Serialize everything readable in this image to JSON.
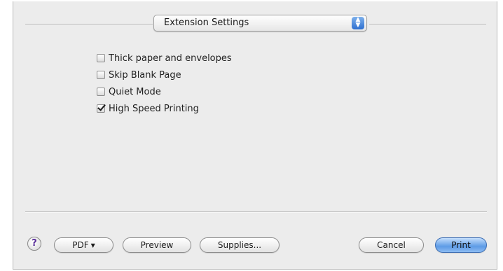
{
  "panel_selector": {
    "selected": "Extension Settings",
    "arrows_icon": "up-down-arrows-icon"
  },
  "options": [
    {
      "label": "Thick paper and envelopes",
      "checked": false
    },
    {
      "label": "Skip Blank Page",
      "checked": false
    },
    {
      "label": "Quiet Mode",
      "checked": false
    },
    {
      "label": "High Speed Printing",
      "checked": true
    }
  ],
  "footer": {
    "help_label": "?",
    "pdf_label": "PDF",
    "pdf_arrow": "▼",
    "preview_label": "Preview",
    "supplies_label": "Supplies...",
    "cancel_label": "Cancel",
    "print_label": "Print"
  },
  "colors": {
    "dialog_background": "#ececec",
    "default_button": "#5d9be6",
    "help_glyph": "#5a2f9a"
  }
}
